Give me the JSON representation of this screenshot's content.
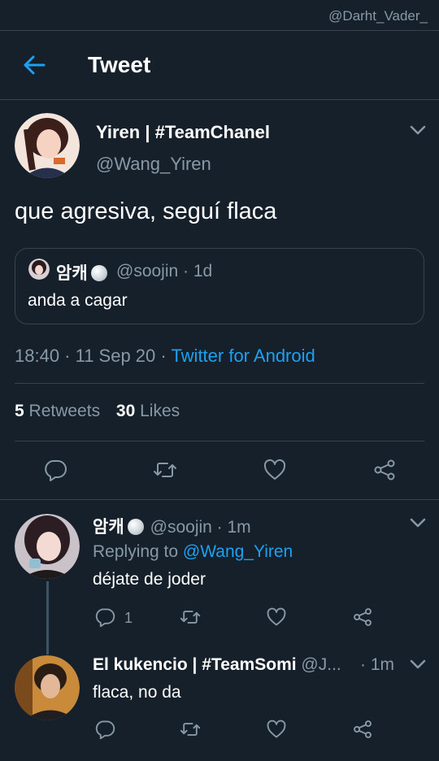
{
  "watermark": "@Darht_Vader_",
  "header": {
    "title": "Tweet"
  },
  "main_tweet": {
    "display_name": "Yiren | #TeamChanel",
    "handle": "@Wang_Yiren",
    "text": "que agresiva, seguí flaca",
    "quote": {
      "display_name": "암캐",
      "handle_time": "@soojin · 1d",
      "text": "anda a cagar"
    },
    "timestamp": "18:40 · 11 Sep 20 · ",
    "source": "Twitter for Android",
    "retweets_count": "5",
    "retweets_label": "Retweets",
    "likes_count": "30",
    "likes_label": "Likes"
  },
  "replies": [
    {
      "display_name": "암캐",
      "handle_time": "@soojin · 1m",
      "replying_prefix": "Replying to ",
      "replying_to": "@Wang_Yiren",
      "text": "déjate de joder",
      "reply_count": "1"
    },
    {
      "display_name": "El kukencio | #TeamSomi",
      "handle": "@J...",
      "time": "· 1m",
      "text": "flaca, no da"
    }
  ],
  "icons": {
    "back": "arrow-left-icon",
    "caret": "chevron-down-icon",
    "reply": "reply-icon",
    "retweet": "retweet-icon",
    "like": "heart-icon",
    "share": "share-icon"
  },
  "colors": {
    "background": "#15202b",
    "accent": "#1da1f2",
    "secondary_text": "#8899a6",
    "divider": "#38444d"
  }
}
